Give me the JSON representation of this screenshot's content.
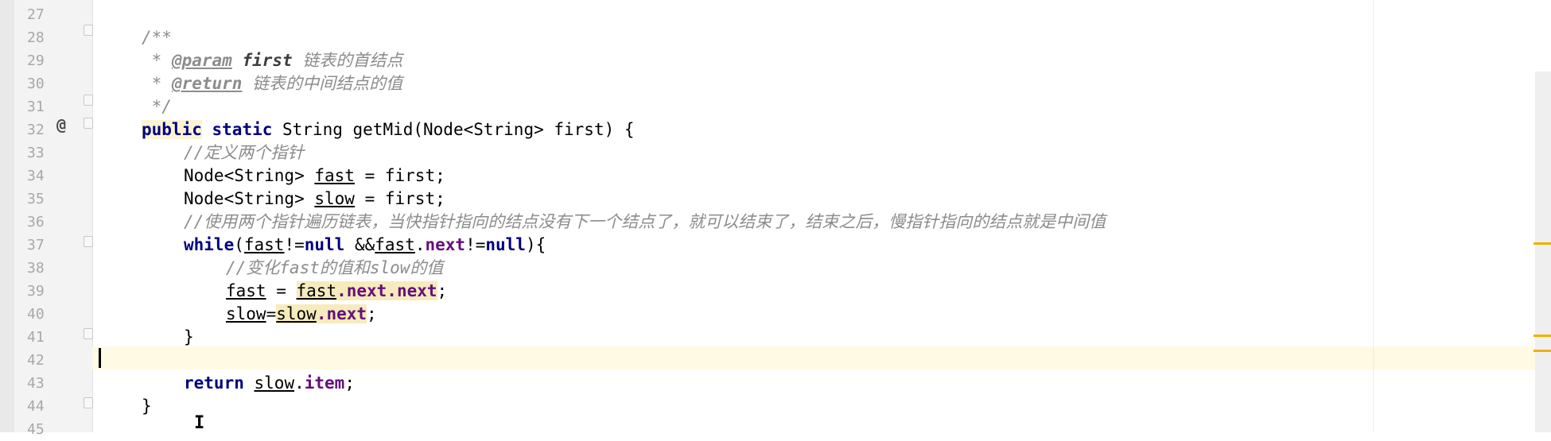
{
  "gutter": {
    "line_numbers": [
      "27",
      "28",
      "29",
      "30",
      "31",
      "32",
      "33",
      "34",
      "35",
      "36",
      "37",
      "38",
      "39",
      "40",
      "41",
      "42",
      "43",
      "44",
      "45"
    ],
    "override_marker": "@"
  },
  "editor": {
    "lines": [
      {
        "num": "27",
        "indent": 0,
        "tokens": []
      },
      {
        "num": "28",
        "indent": 0,
        "tokens": [
          {
            "t": "/**",
            "c": "doc"
          }
        ]
      },
      {
        "num": "29",
        "indent": 0,
        "tokens": [
          {
            "t": " * ",
            "c": "doc"
          },
          {
            "t": "@param",
            "c": "doctag"
          },
          {
            "t": " ",
            "c": "doc"
          },
          {
            "t": "first",
            "c": "docparam"
          },
          {
            "t": " 链表的首结点",
            "c": "doc"
          }
        ]
      },
      {
        "num": "30",
        "indent": 0,
        "tokens": [
          {
            "t": " * ",
            "c": "doc"
          },
          {
            "t": "@return",
            "c": "doctag"
          },
          {
            "t": " 链表的中间结点的值",
            "c": "doc"
          }
        ]
      },
      {
        "num": "31",
        "indent": 0,
        "tokens": [
          {
            "t": " */",
            "c": "doc"
          }
        ]
      },
      {
        "num": "32",
        "indent": 0,
        "tokens": [
          {
            "t": "public",
            "c": "kw-hl"
          },
          {
            "t": " ",
            "c": "plain"
          },
          {
            "t": "static",
            "c": "kw"
          },
          {
            "t": " String getMid(Node<String> first) {",
            "c": "plain"
          }
        ]
      },
      {
        "num": "33",
        "indent": 1,
        "tokens": [
          {
            "t": "//定义两个指针",
            "c": "comment"
          }
        ]
      },
      {
        "num": "34",
        "indent": 1,
        "tokens": [
          {
            "t": "Node<String> ",
            "c": "plain"
          },
          {
            "t": "fast",
            "c": "ul"
          },
          {
            "t": " = first;",
            "c": "plain"
          }
        ]
      },
      {
        "num": "35",
        "indent": 1,
        "tokens": [
          {
            "t": "Node<String> ",
            "c": "plain"
          },
          {
            "t": "slow",
            "c": "ul"
          },
          {
            "t": " = first;",
            "c": "plain"
          }
        ]
      },
      {
        "num": "36",
        "indent": 1,
        "tokens": [
          {
            "t": "//使用两个指针遍历链表，当快指针指向的结点没有下一个结点了，就可以结束了，结束之后，慢指针指向的结点就是中间值",
            "c": "comment"
          }
        ]
      },
      {
        "num": "37",
        "indent": 1,
        "tokens": [
          {
            "t": "while",
            "c": "kw"
          },
          {
            "t": "(",
            "c": "plain"
          },
          {
            "t": "fast",
            "c": "ul"
          },
          {
            "t": "!=",
            "c": "plain"
          },
          {
            "t": "null",
            "c": "kw"
          },
          {
            "t": " &&",
            "c": "plain"
          },
          {
            "t": "fast",
            "c": "ul"
          },
          {
            "t": ".",
            "c": "plain"
          },
          {
            "t": "next",
            "c": "field"
          },
          {
            "t": "!=",
            "c": "plain"
          },
          {
            "t": "null",
            "c": "kw"
          },
          {
            "t": "){",
            "c": "plain"
          }
        ]
      },
      {
        "num": "38",
        "indent": 2,
        "tokens": [
          {
            "t": "//变化fast的值和slow的值",
            "c": "comment"
          }
        ]
      },
      {
        "num": "39",
        "indent": 2,
        "tokens": [
          {
            "t": "fast",
            "c": "ul"
          },
          {
            "t": " = ",
            "c": "plain"
          },
          {
            "t": "fast",
            "c": "ul-hl"
          },
          {
            "t": ".next.next",
            "c": "field-hl"
          },
          {
            "t": ";",
            "c": "plain"
          }
        ]
      },
      {
        "num": "40",
        "indent": 2,
        "tokens": [
          {
            "t": "slow",
            "c": "ul"
          },
          {
            "t": "=",
            "c": "plain"
          },
          {
            "t": "slow",
            "c": "ul-hl"
          },
          {
            "t": ".next",
            "c": "field-hl"
          },
          {
            "t": ";",
            "c": "plain"
          }
        ]
      },
      {
        "num": "41",
        "indent": 1,
        "tokens": [
          {
            "t": "}",
            "c": "plain"
          }
        ]
      },
      {
        "num": "42",
        "indent": 0,
        "tokens": []
      },
      {
        "num": "43",
        "indent": 1,
        "tokens": [
          {
            "t": "return",
            "c": "kw"
          },
          {
            "t": " ",
            "c": "plain"
          },
          {
            "t": "slow",
            "c": "ul"
          },
          {
            "t": ".",
            "c": "plain"
          },
          {
            "t": "item",
            "c": "field"
          },
          {
            "t": ";",
            "c": "plain"
          }
        ]
      },
      {
        "num": "44",
        "indent": 0,
        "tokens": [
          {
            "t": "}",
            "c": "plain"
          }
        ]
      },
      {
        "num": "45",
        "indent": 0,
        "tokens": []
      }
    ]
  },
  "colors": {
    "keyword": "#000080",
    "comment": "#8c8c8c",
    "field": "#660e7a",
    "caret_line": "#fffae3",
    "error_stripe": "#f0b000"
  }
}
